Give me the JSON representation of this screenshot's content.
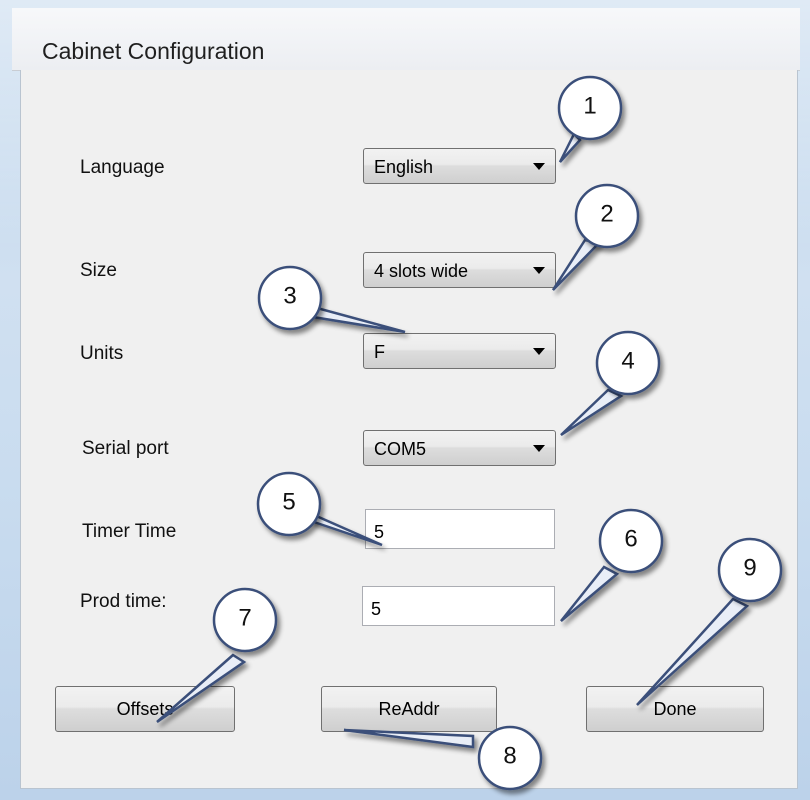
{
  "window": {
    "title": "Cabinet Configuration"
  },
  "fields": {
    "language": {
      "label": "Language",
      "value": "English"
    },
    "size": {
      "label": "Size",
      "value": "4 slots wide"
    },
    "units": {
      "label": "Units",
      "value": "F"
    },
    "serial_port": {
      "label": "Serial port",
      "value": "COM5"
    },
    "timer_time": {
      "label": "Timer Time",
      "value": "5"
    },
    "prod_time": {
      "label": "Prod time:",
      "value": "5"
    }
  },
  "buttons": {
    "offsets": "Offsets",
    "readdr": "ReAddr",
    "done": "Done"
  },
  "callouts": [
    "1",
    "2",
    "3",
    "4",
    "5",
    "6",
    "7",
    "8",
    "9"
  ]
}
